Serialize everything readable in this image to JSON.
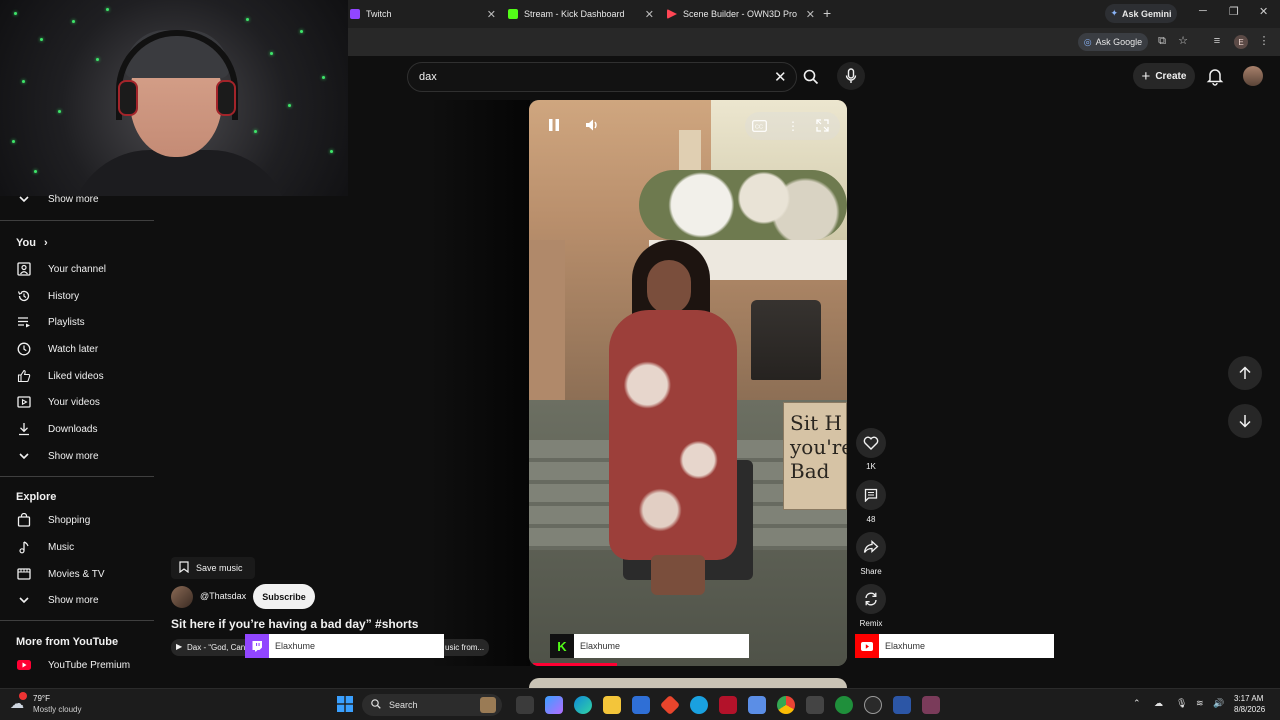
{
  "browser": {
    "tabs": [
      {
        "label": "Twitch",
        "color": "#9146ff"
      },
      {
        "label": "Stream - Kick Dashboard",
        "color": "#53fc18"
      },
      {
        "label": "Scene Builder - OWN3D Pro",
        "color": "#ff4655"
      }
    ],
    "ask_gemini": "Ask Gemini",
    "ask_google": "Ask Google",
    "profile_initial": "E"
  },
  "search": {
    "query": "dax"
  },
  "header": {
    "create_label": "Create"
  },
  "sidebar": {
    "show_more_top": "Show more",
    "you_heading": "You",
    "you_items": [
      "Your channel",
      "History",
      "Playlists",
      "Watch later",
      "Liked videos",
      "Your videos",
      "Downloads"
    ],
    "show_more_you": "Show more",
    "explore_heading": "Explore",
    "explore_items": [
      "Shopping",
      "Music",
      "Movies & TV"
    ],
    "show_more_explore": "Show more",
    "more_heading": "More from YouTube",
    "more_items": [
      "YouTube Premium"
    ]
  },
  "short": {
    "sign_text": "Sit H you're Bad",
    "save_music": "Save music",
    "channel": "@Thatsdax",
    "subscribe": "Subscribe",
    "title": "Sit here if you’re having a bad day” #shorts",
    "music_left": "Dax - “God, Can",
    "music_right": "usic from...",
    "progress_fraction": 0.27,
    "actions": {
      "likes": "1K",
      "comments": "48",
      "share": "Share",
      "remix": "Remix"
    }
  },
  "overlays": [
    {
      "name": "Elaxhume",
      "platform": "twitch",
      "color": "#9146ff"
    },
    {
      "name": "Elaxhume",
      "platform": "kick",
      "color": "#53fc18"
    },
    {
      "name": "Elaxhume",
      "platform": "youtube",
      "color": "#ff0000"
    }
  ],
  "taskbar": {
    "temperature": "79°F",
    "condition": "Mostly cloudy",
    "search_label": "Search",
    "time": "3:17 AM",
    "date": "8/8/2026"
  },
  "colors": {
    "accent": "#ff0033",
    "bg": "#0f0f0f"
  }
}
